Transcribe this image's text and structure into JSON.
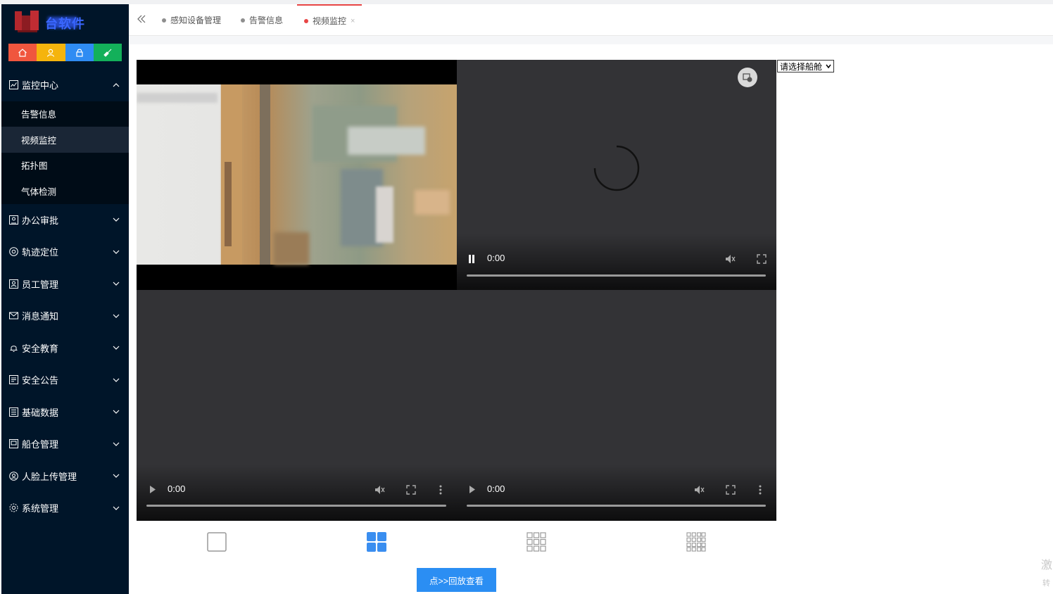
{
  "app": {
    "title": "台软件"
  },
  "quick_actions": [
    {
      "name": "home",
      "icon": "home-icon"
    },
    {
      "name": "user",
      "icon": "user-icon"
    },
    {
      "name": "lock",
      "icon": "lock-icon"
    },
    {
      "name": "clean",
      "icon": "broom-icon"
    }
  ],
  "sidebar": {
    "active_group": {
      "label": "监控中心",
      "icon": "monitor-chart-icon",
      "expanded": true,
      "children": [
        {
          "label": "告警信息",
          "active": false
        },
        {
          "label": "视频监控",
          "active": true
        },
        {
          "label": "拓扑图",
          "active": false
        },
        {
          "label": "气体检测",
          "active": false
        }
      ]
    },
    "groups": [
      {
        "label": "办公审批",
        "icon": "approval-icon"
      },
      {
        "label": "轨迹定位",
        "icon": "location-icon"
      },
      {
        "label": "员工管理",
        "icon": "staff-icon"
      },
      {
        "label": "消息通知",
        "icon": "mail-icon"
      },
      {
        "label": "安全教育",
        "icon": "bell-icon"
      },
      {
        "label": "安全公告",
        "icon": "notice-icon"
      },
      {
        "label": "基础数据",
        "icon": "data-icon"
      },
      {
        "label": "船仓管理",
        "icon": "cabin-icon"
      },
      {
        "label": "人脸上传管理",
        "icon": "face-icon"
      },
      {
        "label": "系统管理",
        "icon": "settings-icon"
      }
    ]
  },
  "tabs": [
    {
      "label": "感知设备管理",
      "active": false
    },
    {
      "label": "告警信息",
      "active": false
    },
    {
      "label": "视频监控",
      "active": true,
      "close": "×"
    }
  ],
  "ship_select": {
    "selected": "请选择船舱"
  },
  "players": [
    {
      "state": "live-feed",
      "time": ""
    },
    {
      "state": "loading",
      "time": "0:00",
      "control": "pause"
    },
    {
      "state": "idle",
      "time": "0:00",
      "control": "play"
    },
    {
      "state": "idle",
      "time": "0:00",
      "control": "play"
    }
  ],
  "layouts": [
    {
      "name": "1x1",
      "active": false
    },
    {
      "name": "2x2",
      "active": true
    },
    {
      "name": "3x3",
      "active": false
    },
    {
      "name": "4x4",
      "active": false
    }
  ],
  "playback_button": {
    "label": "点>>回放查看"
  },
  "colors": {
    "sidebar_bg": "#001529",
    "accent": "#2b8ef3",
    "tab_active": "#e84545",
    "player_bg": "#333336"
  }
}
